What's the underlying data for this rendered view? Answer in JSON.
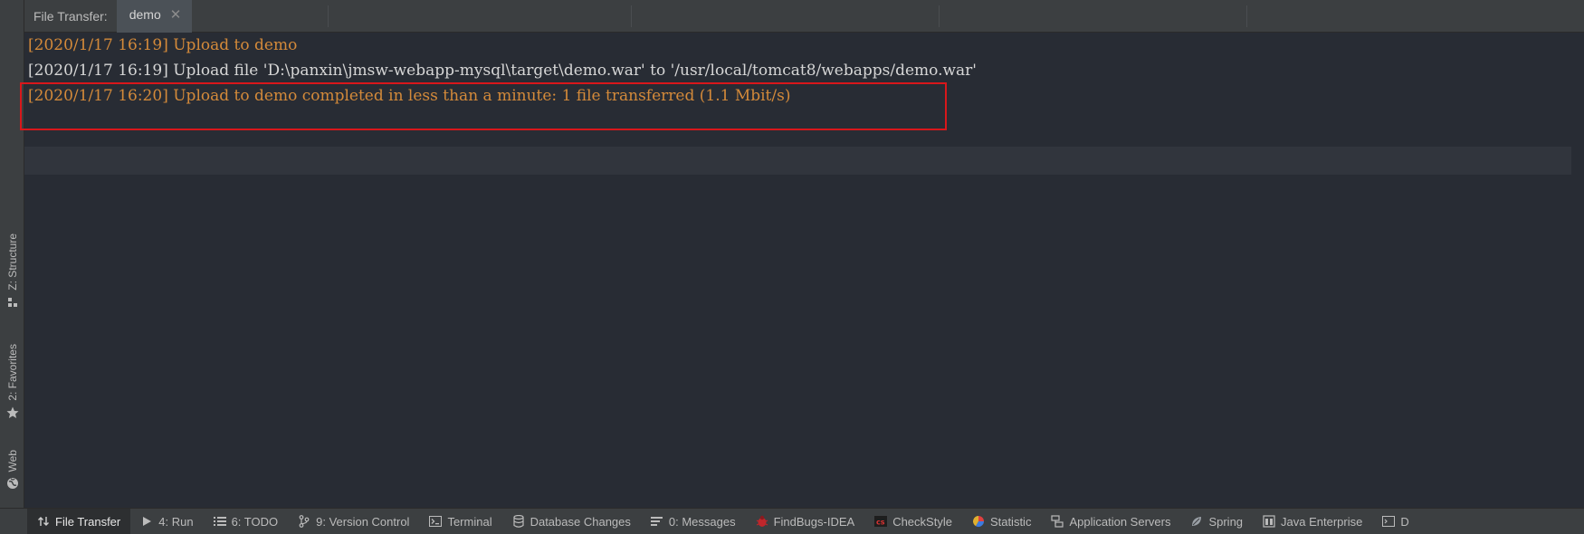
{
  "left_strip": {
    "tabs": [
      {
        "label": "Z: Structure",
        "icon": "structure-icon"
      },
      {
        "label": "2: Favorites",
        "icon": "star-icon"
      },
      {
        "label": "Web",
        "icon": "globe-icon"
      }
    ]
  },
  "header": {
    "label": "File Transfer:",
    "tab_label": "demo",
    "close_glyph": "✕"
  },
  "console": {
    "lines": [
      {
        "text": "[2020/1/17 16:19] Upload to demo",
        "color": "#d48a3a"
      },
      {
        "text": "[2020/1/17 16:19] Upload file 'D:\\panxin\\jmsw-webapp-mysql\\target\\demo.war' to '/usr/local/tomcat8/webapps/demo.war'",
        "color": "#d6d6d6"
      },
      {
        "text": "[2020/1/17 16:20] Upload to demo completed in less than a minute: 1 file transferred (1.1 Mbit/s)",
        "color": "#d48a3a"
      }
    ],
    "highlight_color": "#d8171b"
  },
  "bottom_bar": {
    "items": [
      {
        "label": "File Transfer",
        "icon": "transfer-arrows-icon",
        "active": true
      },
      {
        "label": "4: Run",
        "icon": "run-icon",
        "active": false
      },
      {
        "label": "6: TODO",
        "icon": "todo-list-icon",
        "active": false
      },
      {
        "label": "9: Version Control",
        "icon": "version-control-icon",
        "active": false
      },
      {
        "label": "Terminal",
        "icon": "terminal-icon",
        "active": false
      },
      {
        "label": "Database Changes",
        "icon": "database-icon",
        "active": false
      },
      {
        "label": "0: Messages",
        "icon": "messages-icon",
        "active": false
      },
      {
        "label": "FindBugs-IDEA",
        "icon": "bug-icon",
        "active": false
      },
      {
        "label": "CheckStyle",
        "icon": "checkstyle-icon",
        "active": false
      },
      {
        "label": "Statistic",
        "icon": "statistic-icon",
        "active": false
      },
      {
        "label": "Application Servers",
        "icon": "server-icon",
        "active": false
      },
      {
        "label": "Spring",
        "icon": "spring-leaf-icon",
        "active": false
      },
      {
        "label": "Java Enterprise",
        "icon": "java-enterprise-icon",
        "active": false
      },
      {
        "label": "D",
        "icon": "docker-icon",
        "active": false
      }
    ]
  },
  "colors": {
    "console_bg": "#282c34",
    "panel_bg": "#3c3f41",
    "orange_text": "#d48a3a",
    "white_text": "#d6d6d6"
  }
}
